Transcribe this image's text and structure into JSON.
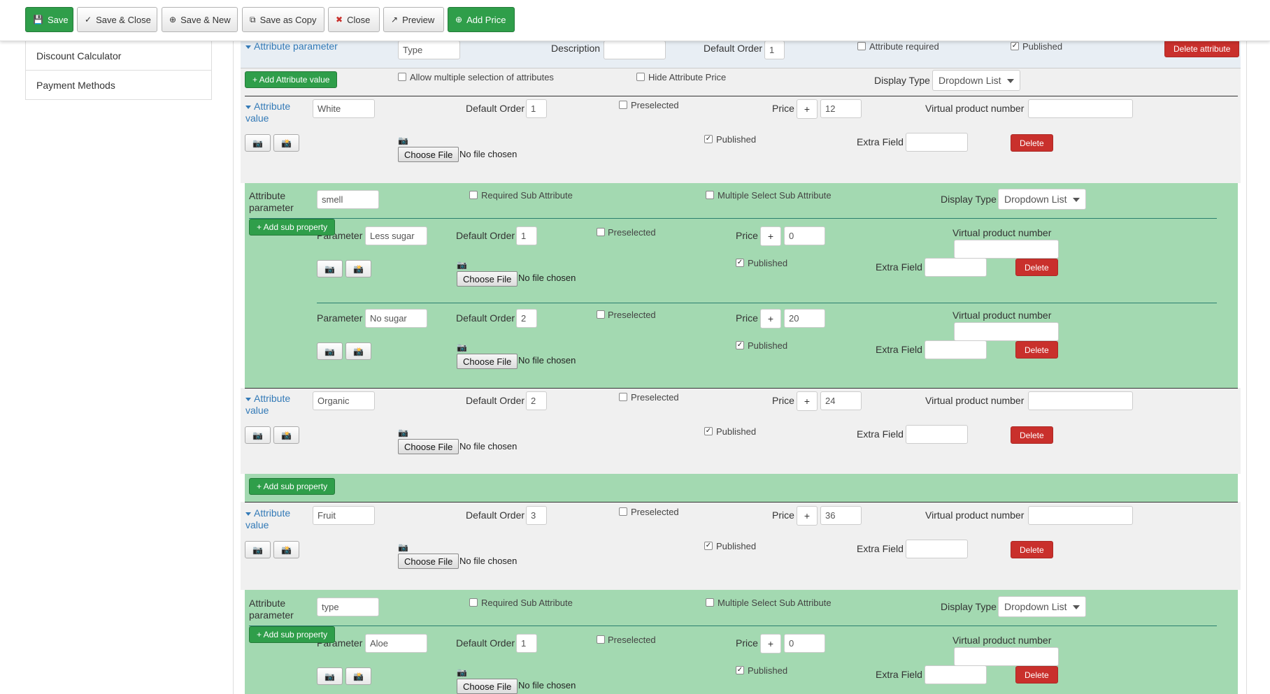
{
  "toolbar": {
    "save": "Save",
    "save_close": "Save & Close",
    "save_new": "Save & New",
    "save_copy": "Save as Copy",
    "close": "Close",
    "preview": "Preview",
    "add_price": "Add Price"
  },
  "sidebar": {
    "items": [
      {
        "label": "Discount Calculator"
      },
      {
        "label": "Payment Methods"
      }
    ]
  },
  "labels": {
    "attribute_parameter": "Attribute parameter",
    "description": "Description",
    "default_order": "Default Order",
    "attribute_required": "Attribute required",
    "published": "Published",
    "delete_attribute": "Delete attribute",
    "add_attribute_value": "+ Add Attribute value",
    "allow_multiple": "Allow multiple selection of attributes",
    "hide_price": "Hide Attribute Price",
    "display_type": "Display Type",
    "attribute_value_1": "Attribute",
    "attribute_value_2": "value",
    "preselected": "Preselected",
    "price": "Price",
    "virtual_product_number": "Virtual product number",
    "extra_field": "Extra Field",
    "delete": "Delete",
    "choose_file": "Choose File",
    "no_file": "No file chosen",
    "sub_param_1": "Attribute",
    "sub_param_2": "parameter",
    "required_sub": "Required Sub Attribute",
    "multiple_select_sub": "Multiple Select Sub Attribute",
    "add_sub_property": "+ Add sub property",
    "parameter": "Parameter",
    "plus": "+"
  },
  "attribute": {
    "name": "Type",
    "description": "",
    "default_order": "1",
    "display_type": "Dropdown List"
  },
  "values": [
    {
      "name": "White",
      "order": "1",
      "price": "12"
    },
    {
      "name": "Organic",
      "order": "2",
      "price": "24"
    },
    {
      "name": "Fruit",
      "order": "3",
      "price": "36"
    }
  ],
  "subgroups": [
    {
      "name": "smell",
      "display_type": "Dropdown List",
      "items": [
        {
          "name": "Less sugar",
          "order": "1",
          "price": "0"
        },
        {
          "name": "No sugar",
          "order": "2",
          "price": "20"
        }
      ]
    },
    {
      "name": "type",
      "display_type": "Dropdown List",
      "items": [
        {
          "name": "Aloe",
          "order": "1",
          "price": "0"
        }
      ]
    }
  ],
  "icons": {
    "save": "floppy-icon",
    "copy": "copy-icon",
    "close": "close-circle-icon",
    "preview": "external-link-icon",
    "add": "plus-circle-icon",
    "camera": "camera-icon"
  }
}
